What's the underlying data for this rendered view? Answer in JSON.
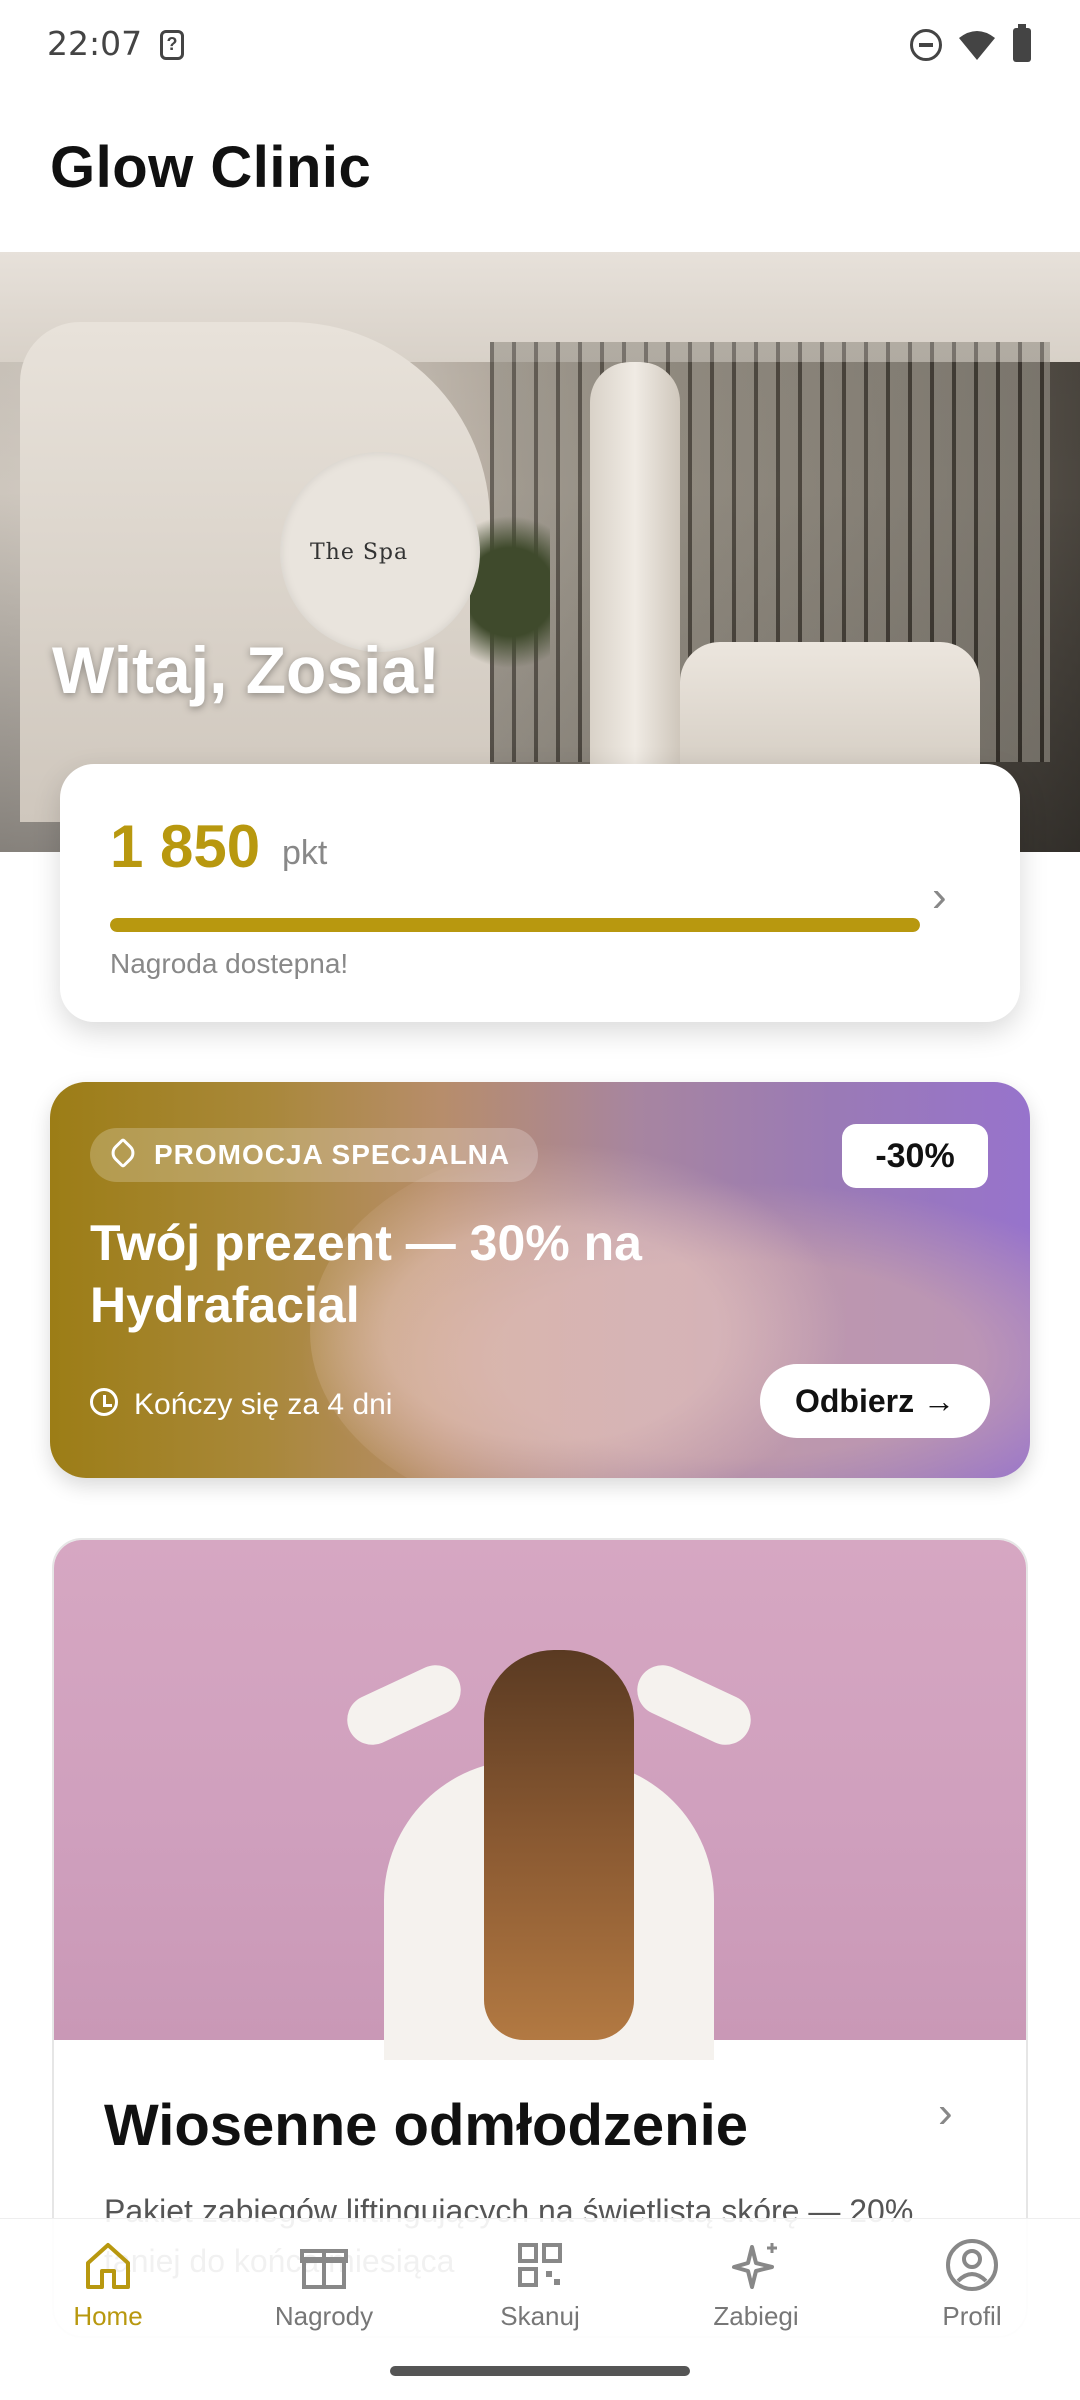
{
  "status_bar": {
    "time": "22:07",
    "icons": [
      "notification-icon",
      "do-not-disturb-icon",
      "wifi-icon",
      "battery-icon"
    ]
  },
  "app_bar": {
    "title": "Glow Clinic"
  },
  "hero": {
    "greeting": "Witaj, Zosia!",
    "sign_text": "The Spa"
  },
  "points": {
    "value": "1 850",
    "unit": "pkt",
    "progress": 1.0,
    "note": "Nagroda dostepna!",
    "accent_color": "#b8980f"
  },
  "promo": {
    "badge": "PROMOCJA SPECJALNA",
    "discount": "-30%",
    "headline": "Twój prezent — 30% na Hydrafacial",
    "expiry": "Kończy się za 4 dni",
    "cta": "Odbierz →"
  },
  "package": {
    "title": "Wiosenne odmłodzenie",
    "description": "Pakiet zabiegów liftingujących na świetlistą skórę — 20% taniej do końca miesiąca"
  },
  "nav": {
    "items": [
      {
        "label": "Home",
        "icon": "home-icon",
        "active": true
      },
      {
        "label": "Nagrody",
        "icon": "gift-icon",
        "active": false
      },
      {
        "label": "Skanuj",
        "icon": "qr-icon",
        "active": false
      },
      {
        "label": "Zabiegi",
        "icon": "sparkle-icon",
        "active": false
      },
      {
        "label": "Profil",
        "icon": "profile-icon",
        "active": false
      }
    ]
  }
}
